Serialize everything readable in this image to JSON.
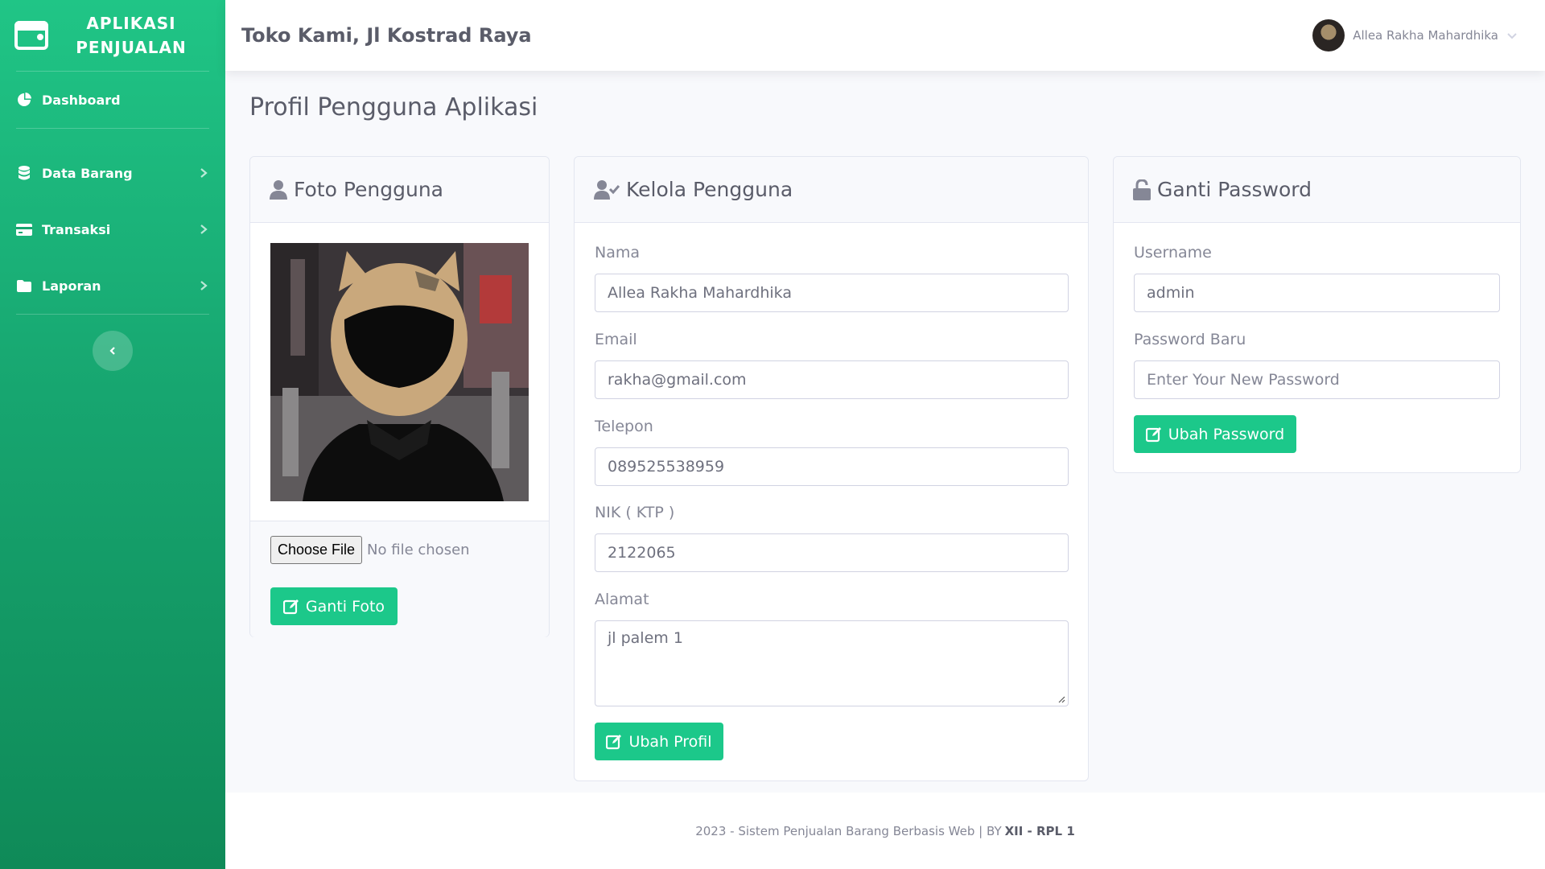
{
  "app": {
    "title_line1": "APLIKASI",
    "title_line2": "PENJUALAN"
  },
  "sidebar": {
    "items": [
      {
        "label": "Dashboard",
        "icon": "dashboard-icon",
        "has_chevron": false
      },
      {
        "label": "Data Barang",
        "icon": "database-icon",
        "has_chevron": true
      },
      {
        "label": "Transaksi",
        "icon": "credit-card-icon",
        "has_chevron": true
      },
      {
        "label": "Laporan",
        "icon": "folder-icon",
        "has_chevron": true
      }
    ],
    "toggle_icon": "chevron-left-icon"
  },
  "topbar": {
    "store_name": "Toko Kami, Jl Kostrad Raya",
    "user_name": "Allea Rakha Mahardhika"
  },
  "page": {
    "title": "Profil Pengguna Aplikasi"
  },
  "photo_card": {
    "header": "Foto Pengguna",
    "file_button": "Choose File",
    "file_status": "No file chosen",
    "submit_label": "Ganti Foto"
  },
  "kelola_card": {
    "header": "Kelola Pengguna",
    "fields": {
      "nama_label": "Nama",
      "nama_value": "Allea Rakha Mahardhika",
      "email_label": "Email",
      "email_value": "rakha@gmail.com",
      "telepon_label": "Telepon",
      "telepon_value": "089525538959",
      "nik_label": "NIK ( KTP )",
      "nik_value": "2122065",
      "alamat_label": "Alamat",
      "alamat_value": "jl palem 1"
    },
    "submit_label": "Ubah Profil"
  },
  "password_card": {
    "header": "Ganti Password",
    "username_label": "Username",
    "username_value": "admin",
    "password_label": "Password Baru",
    "password_placeholder": "Enter Your New Password",
    "submit_label": "Ubah Password"
  },
  "footer": {
    "text": "2023 - Sistem Penjualan Barang Berbasis Web | BY",
    "bold": "XII - RPL 1"
  },
  "colors": {
    "accent": "#1cc88a",
    "sidebar_top": "#20c586",
    "sidebar_bottom": "#0f8a58",
    "text_dark": "#5a5c69",
    "text_muted": "#858796",
    "page_bg": "#f8f9fc"
  }
}
